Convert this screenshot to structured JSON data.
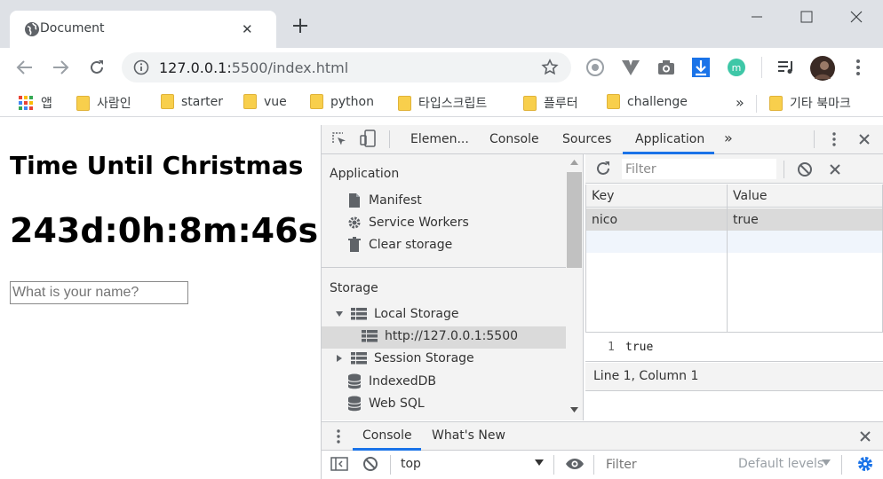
{
  "browser": {
    "tab_title": "Document",
    "tab_close": "✕",
    "new_tab": "+",
    "url_host": "127.0.0.1:",
    "url_path": "5500/index.html",
    "bookmarks": [
      {
        "label": "앱"
      },
      {
        "label": "사람인"
      },
      {
        "label": "starter"
      },
      {
        "label": "vue"
      },
      {
        "label": "python"
      },
      {
        "label": "타입스크립트"
      },
      {
        "label": "플루터"
      },
      {
        "label": "challenge"
      }
    ],
    "bookmarks_more": "»",
    "other_bookmarks": "기타 북마크"
  },
  "page": {
    "title": "Time Until Christmas",
    "countdown": "243d:0h:8m:46s",
    "name_placeholder": "What is your name?"
  },
  "devtools": {
    "tabs": [
      "Elemen...",
      "Console",
      "Sources",
      "Application"
    ],
    "active_tab": "Application",
    "more_tabs": "»",
    "sidebar": {
      "application_header": "Application",
      "application_items": [
        "Manifest",
        "Service Workers",
        "Clear storage"
      ],
      "storage_header": "Storage",
      "local_storage": "Local Storage",
      "local_storage_origin": "http://127.0.0.1:5500",
      "session_storage": "Session Storage",
      "indexeddb": "IndexedDB",
      "websql": "Web SQL"
    },
    "filter_placeholder": "Filter",
    "table": {
      "headers": [
        "Key",
        "Value"
      ],
      "rows": [
        {
          "key": "nico",
          "value": "true"
        }
      ]
    },
    "preview": {
      "line": "1",
      "text": "true"
    },
    "status": "Line 1, Column 1",
    "drawer": {
      "tabs": [
        "Console",
        "What's New"
      ],
      "context": "top",
      "filter_placeholder": "Filter",
      "levels": "Default levels"
    }
  },
  "colors": {
    "accent": "#1a73e8",
    "folder": "#f8cf4c"
  }
}
